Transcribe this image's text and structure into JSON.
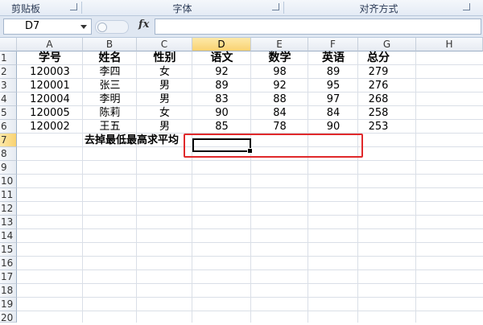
{
  "ribbon": {
    "groups": [
      {
        "label": "剪贴板"
      },
      {
        "label": "字体"
      },
      {
        "label": "对齐方式"
      }
    ]
  },
  "formula_bar": {
    "name_box": "D7",
    "fx_label": "fx",
    "formula": ""
  },
  "columns": [
    "A",
    "B",
    "C",
    "D",
    "E",
    "F",
    "G",
    "H"
  ],
  "selected_column": "D",
  "rows": [
    "1",
    "2",
    "3",
    "4",
    "5",
    "6",
    "7",
    "8",
    "9",
    "10",
    "11",
    "12",
    "13",
    "14",
    "15",
    "16",
    "17",
    "18",
    "19",
    "20"
  ],
  "selected_row": "7",
  "table": {
    "headers": [
      "学号",
      "姓名",
      "性别",
      "语文",
      "数学",
      "英语",
      "总分"
    ],
    "records": [
      [
        "120003",
        "李四",
        "女",
        "92",
        "98",
        "89",
        "279"
      ],
      [
        "120001",
        "张三",
        "男",
        "89",
        "92",
        "95",
        "276"
      ],
      [
        "120004",
        "李明",
        "男",
        "83",
        "88",
        "97",
        "268"
      ],
      [
        "120005",
        "陈莉",
        "女",
        "90",
        "84",
        "84",
        "258"
      ],
      [
        "120002",
        "王五",
        "男",
        "85",
        "78",
        "90",
        "253"
      ]
    ],
    "note": "去掉最低最高求平均"
  },
  "colors": {
    "highlight": "#e0292b",
    "selected_header": "#f9d271"
  }
}
